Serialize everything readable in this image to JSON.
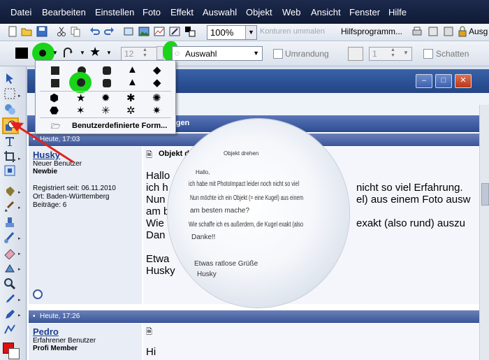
{
  "menu": [
    "Datei",
    "Bearbeiten",
    "Einstellen",
    "Foto",
    "Effekt",
    "Auswahl",
    "Objekt",
    "Web",
    "Ansicht",
    "Fenster",
    "Hilfe"
  ],
  "toolbar1": {
    "zoom": "100%",
    "konturen": "Konturen ummalen",
    "hilfsprogramme": "Hilfsprogramm...",
    "ausgabe": "Ausg"
  },
  "toolbar2": {
    "size_value": "12",
    "mode_value": "Auswahl",
    "umrandung_label": "Umrandung",
    "stroke_value": "1",
    "schatten_label": "Schatten"
  },
  "dropdown": {
    "custom_label": "Benutzerdefinierte Form..."
  },
  "forum": {
    "partial_title": "ngen",
    "post1": {
      "time": "Heute, 17:03",
      "user": "Husky",
      "role1": "Neuer Benutzer",
      "rank": "Newbie",
      "registered": "Registriert seit: 06.11.2010",
      "location": "Ort: Baden-Württemberg",
      "posts": "Beiträge: 6",
      "subject": "Objekt d",
      "lines": [
        "Hallo",
        "ich h",
        "Nun",
        "am b",
        "Wie",
        "Dan",
        "",
        "Etwa",
        "Husky"
      ],
      "right_lines": [
        "nicht so viel Erfahrung.",
        "el) aus einem Foto ausw",
        "",
        "exakt (also rund) auszu"
      ]
    },
    "post2": {
      "time": "Heute, 17:26",
      "user": "Pedro",
      "role1": "Erfahrener Benutzer",
      "rank": "Profi Member",
      "first": "Hi"
    }
  },
  "sphere_text": {
    "title": "Objekt drehen",
    "lines": [
      "Hallo,",
      "ich habe mit PhotoImpact leider noch nicht so viel",
      "Nun möchte ich ein Objekt (= eine Kugel) aus einem",
      "am besten mache?",
      "Wie schaffe ich es außerdem, die Kugel exakt (also",
      "Danke!!",
      "",
      "Etwas ratlose Grüße",
      "Husky"
    ]
  },
  "colors": {
    "menubar": "#1d2a4c",
    "highlight_green": "#19d419",
    "arrow_red": "#e0231c",
    "link_blue": "#1a3d8f"
  }
}
